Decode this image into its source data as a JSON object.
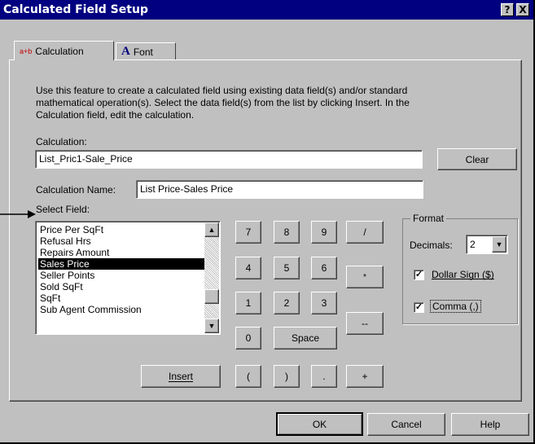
{
  "window": {
    "title": "Calculated Field Setup",
    "help_glyph": "?",
    "close_glyph": "X"
  },
  "tabs": [
    {
      "icon_text": "a+b",
      "label": "Calculation"
    },
    {
      "icon_text": "A",
      "label": "Font"
    }
  ],
  "description": {
    "line1": "Use this feature to create a calculated field using existing data field(s) and/or standard",
    "line2": "mathematical operation(s).  Select the data field(s) from the list by clicking Insert.  In the",
    "line3": "Calculation field, edit the calculation."
  },
  "calculation": {
    "label": "Calculation:",
    "value": "List_Pric1-Sale_Price",
    "clear_label": "Clear"
  },
  "calculation_name": {
    "label": "Calculation Name:",
    "value": "List Price-Sales Price"
  },
  "select_field": {
    "label": "Select Field:",
    "items": [
      "Price Per SqFt",
      "Refusal Hrs",
      "Repairs Amount",
      "Sales Price",
      "Seller Points",
      "Sold SqFt",
      "SqFt",
      "Sub Agent Commission"
    ],
    "selected": "Sales Price",
    "scroll_up_glyph": "▲",
    "scroll_down_glyph": "▼"
  },
  "insert_label": "Insert",
  "keypad": {
    "digits": [
      "7",
      "8",
      "9",
      "4",
      "5",
      "6",
      "1",
      "2",
      "3",
      "0"
    ],
    "space": "Space",
    "open_paren": "(",
    "close_paren": ")",
    "dot": ".",
    "divide": "/",
    "multiply": "*",
    "minus": "--",
    "plus": "+"
  },
  "format": {
    "legend": "Format",
    "decimals_label": "Decimals:",
    "decimals_value": "2",
    "dollar_label": "Dollar Sign ($)",
    "dollar_checked": true,
    "comma_label": "Comma (,)",
    "comma_checked": true,
    "check_glyph": "✓"
  },
  "footer": {
    "ok": "OK",
    "cancel": "Cancel",
    "help": "Help"
  }
}
